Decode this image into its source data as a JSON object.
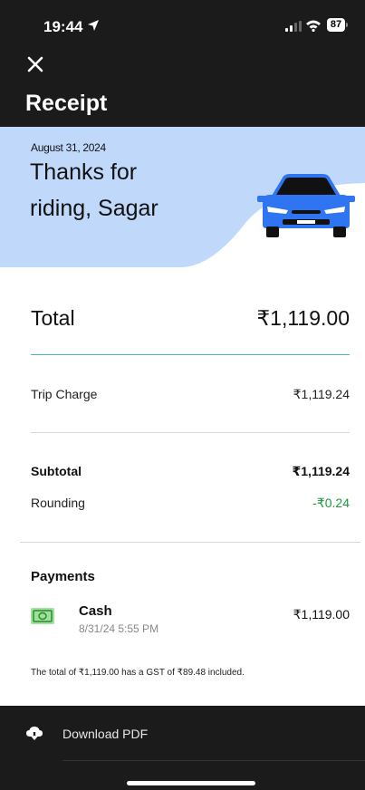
{
  "status_bar": {
    "time": "19:44",
    "battery": "87"
  },
  "header": {
    "title": "Receipt",
    "close_icon": "close-icon"
  },
  "banner": {
    "date": "August 31, 2024",
    "thanks_line1": "Thanks for",
    "thanks_line2": "riding, Sagar",
    "car_icon": "car-icon",
    "colors": {
      "background": "#c0d9fb",
      "car": "#2f74f0"
    }
  },
  "totals": {
    "total_label": "Total",
    "total_value": "₹1,119.00",
    "trip_charge_label": "Trip Charge",
    "trip_charge_value": "₹1,119.24",
    "subtotal_label": "Subtotal",
    "subtotal_value": "₹1,119.24",
    "rounding_label": "Rounding",
    "rounding_value": "-₹0.24",
    "colors": {
      "divider": "#47b8b4",
      "negative": "#1a9a3a"
    }
  },
  "payments": {
    "heading": "Payments",
    "items": [
      {
        "method": "Cash",
        "datetime": "8/31/24 5:55 PM",
        "amount": "₹1,119.00",
        "icon": "cash-icon"
      }
    ]
  },
  "gst_note": "The total of ₹1,119.00 has a GST of ₹89.48 included.",
  "footer": {
    "download_label": "Download PDF",
    "download_icon": "cloud-download-icon"
  }
}
